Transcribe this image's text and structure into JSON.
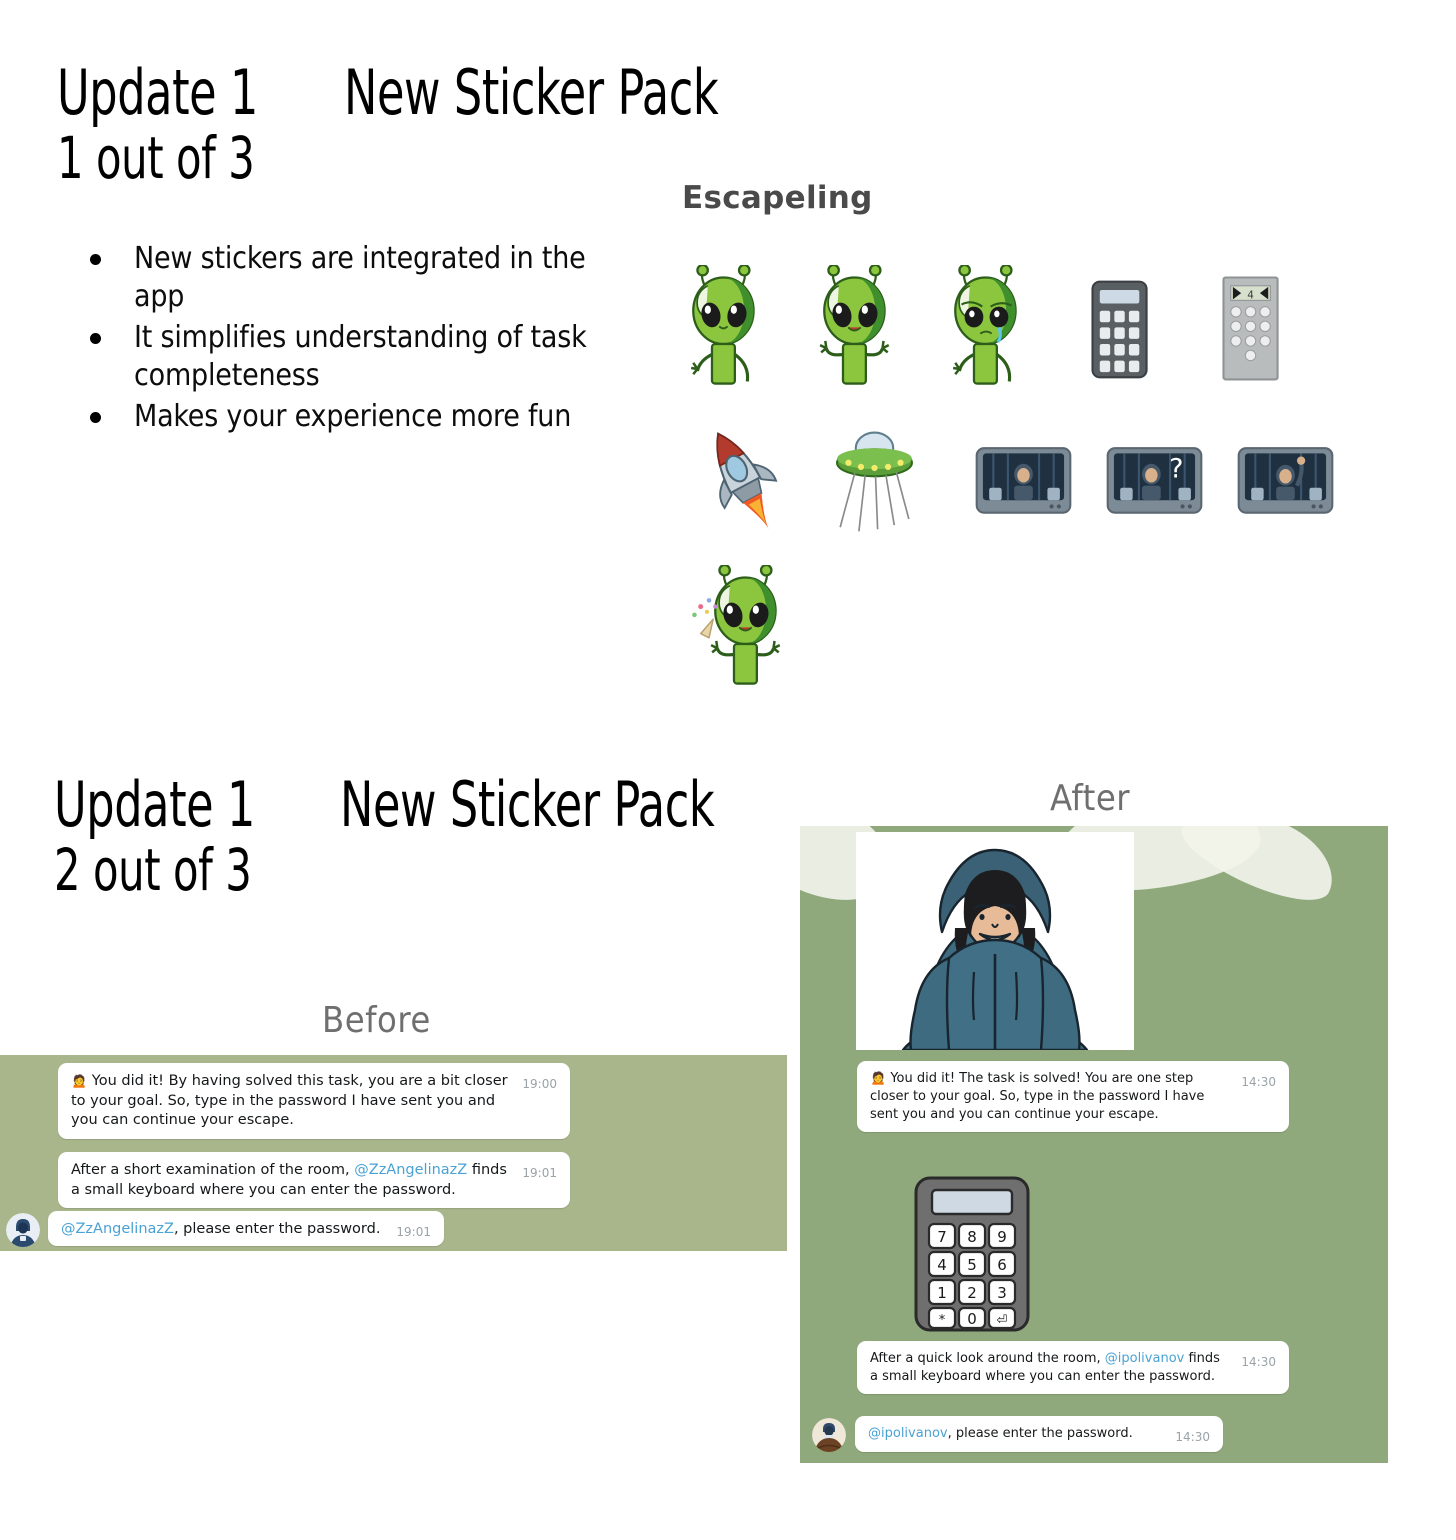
{
  "slide1": {
    "title_part1": "Update 1",
    "title_part2": "New Sticker Pack",
    "title_part3": "1 out of 3",
    "bullets": [
      "New stickers are integrated in the app",
      "It simplifies understanding of task completeness",
      "Makes your experience more fun"
    ],
    "sticker_pack": {
      "name": "Escapeling",
      "stickers": [
        {
          "name": "alien-waving",
          "label": "Alien waving"
        },
        {
          "name": "alien-cheering",
          "label": "Alien with both hands up"
        },
        {
          "name": "alien-crying",
          "label": "Sad crying alien"
        },
        {
          "name": "calculator-keypad",
          "label": "Dark calculator keypad"
        },
        {
          "name": "door-keypad-panel",
          "label": "Grey wall keypad panel"
        },
        {
          "name": "rocket",
          "label": "Rocket ship"
        },
        {
          "name": "ufo",
          "label": "Flying saucer UFO"
        },
        {
          "name": "screen-prisoner",
          "label": "Monitor with hooded person"
        },
        {
          "name": "screen-question",
          "label": "Monitor with question mark"
        },
        {
          "name": "screen-hand-raised",
          "label": "Monitor with person raising hand"
        },
        {
          "name": "alien-party",
          "label": "Alien celebrating with party popper"
        }
      ]
    }
  },
  "slide2": {
    "title_part1": "Update 1",
    "title_part2": "New Sticker Pack",
    "title_part3": "2 out of 3",
    "before_label": "Before",
    "after_label": "After",
    "before_chat": {
      "background_color": "#a9b68c",
      "messages": [
        {
          "emoji": "🙍",
          "text": "You did it! By having solved this task, you are a bit closer to your goal. So, type in the password I have sent you and you can continue your escape.",
          "time": "19:00"
        },
        {
          "text_before": "After a short examination of the room, ",
          "mention": "@ZzAngelinazZ",
          "text_after": " finds a small keyboard where you can enter the password.",
          "time": "19:01"
        },
        {
          "mention": "@ZzAngelinazZ",
          "text_after": ", please enter the password.",
          "time": "19:01",
          "has_avatar": true
        }
      ]
    },
    "after_chat": {
      "background_color": "#90a97c",
      "sticker_person": "hooded-person-smiling",
      "sticker_keypad": "keypad",
      "keypad_keys": [
        "7",
        "8",
        "9",
        "4",
        "5",
        "6",
        "1",
        "2",
        "3",
        "*",
        "0",
        "⏎"
      ],
      "messages": [
        {
          "emoji": "🙍",
          "text": "You did it! The task is solved! You are one step closer to your goal. So, type in the password I have sent you and you can continue your escape.",
          "time": "14:30"
        },
        {
          "text_before": "After a quick look around the room, ",
          "mention": "@ipolivanov",
          "text_after": " finds a small keyboard where you can enter the password.",
          "time": "14:30"
        },
        {
          "mention": "@ipolivanov",
          "text_after": ", please enter the password.",
          "time": "14:30",
          "has_avatar": true
        }
      ]
    }
  },
  "colors": {
    "mention_blue": "#4aa2d4",
    "alien_green": "#7ab648",
    "chat_green_light": "#a9b68c",
    "chat_green_dark": "#90a97c",
    "hoodie_blue": "#3f6b80"
  }
}
